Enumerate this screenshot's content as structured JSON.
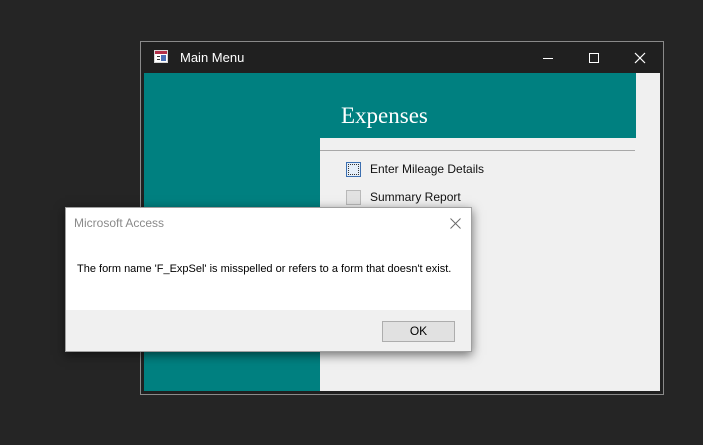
{
  "main_window": {
    "title": "Main Menu",
    "icons": {
      "app": "access-form-icon",
      "minimize": "minimize-icon",
      "maximize": "maximize-icon",
      "close": "close-icon"
    }
  },
  "form": {
    "title": "Expenses",
    "menu_items": [
      {
        "label": "Enter Mileage Details",
        "focused": true
      },
      {
        "label": "Summary Report",
        "focused": false
      }
    ]
  },
  "dialog": {
    "title": "Microsoft Access",
    "message": "The form name 'F_ExpSel' is misspelled or refers to a form that doesn't exist.",
    "ok_label": "OK",
    "close_icon": "close-icon"
  },
  "colors": {
    "accent_teal": "#008080",
    "desktop": "#252525",
    "titlebar": "#202020",
    "form_background": "#f0f0f0"
  }
}
